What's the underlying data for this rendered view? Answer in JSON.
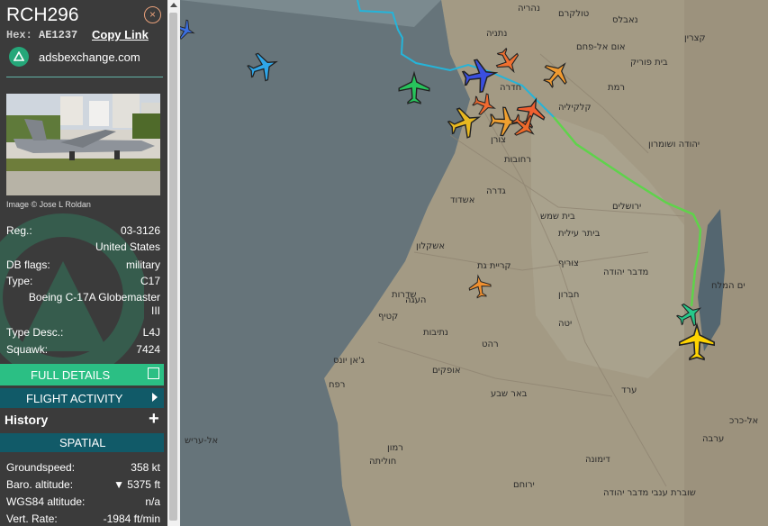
{
  "aircraft": {
    "callsign": "RCH296",
    "hex_label": "Hex:",
    "hex": "AE1237",
    "copy_link": "Copy Link",
    "link_text": "adsbexchange.com",
    "image_credit": "Image © Jose L Roldan"
  },
  "details": [
    {
      "key": "Reg.:",
      "value": "03-3126"
    },
    {
      "key": "",
      "value": "United States"
    },
    {
      "key": "DB flags:",
      "value": "military"
    },
    {
      "key": "Type:",
      "value": "C17"
    },
    {
      "key": "",
      "value": "Boeing C-17A Globemaster"
    },
    {
      "key": "",
      "value": "III"
    },
    {
      "key": "Type Desc.:",
      "value": "L4J"
    },
    {
      "key": "Squawk:",
      "value": "7424"
    }
  ],
  "buttons": {
    "full_details": "FULL DETAILS",
    "flight_activity": "FLIGHT ACTIVITY",
    "history": "History",
    "history_toggle": "+",
    "spatial": "SPATIAL",
    "close": "×"
  },
  "spatial": [
    {
      "key": "Groundspeed:",
      "value": "358 kt"
    },
    {
      "key": "Baro. altitude:",
      "value": "▼ 5375 ft"
    },
    {
      "key": "WGS84 altitude:",
      "value": "n/a"
    },
    {
      "key": "Vert. Rate:",
      "value": "-1984 ft/min"
    }
  ],
  "map_labels": [
    "נהריה",
    "טולקרם",
    "בית פוריק",
    "חדרה",
    "רמת",
    "קלקיליה",
    "צורן",
    "יהודה ושומרון",
    "רחובות",
    "אשדוד",
    "גדרה",
    "ירושלים",
    "בית שמש",
    "ביתר עילית",
    "אשקלון",
    "קריית גת",
    "צוריף",
    "חברון",
    "רהט",
    "באר שבע",
    "ערד",
    "ירוחם",
    "דימונה",
    "יטה",
    "אופקים",
    "נתיבות",
    "שדרות",
    "רפח",
    "קטיף",
    "ג'אן יונס",
    "אל-עריש",
    "העגה",
    "רמון",
    "שוברת ענבי מדבר יהודה",
    "מדבר יהודה",
    "ים המלח",
    "אל-כרכ",
    "חוליתה",
    "ערבה",
    "אום אל-פחם",
    "נאבלס",
    "קצרין",
    "נתניה"
  ],
  "colors": {
    "sidebar_bg": "#3b3b3b",
    "accent_green": "#2bbf84",
    "accent_teal": "#115a68",
    "selected_plane": "#ffd400"
  },
  "icons": {
    "close": "close-icon",
    "logo": "adsbx-logo-icon",
    "external": "external-link-icon",
    "arrow": "chevron-right-icon",
    "plane": "airplane-icon"
  }
}
